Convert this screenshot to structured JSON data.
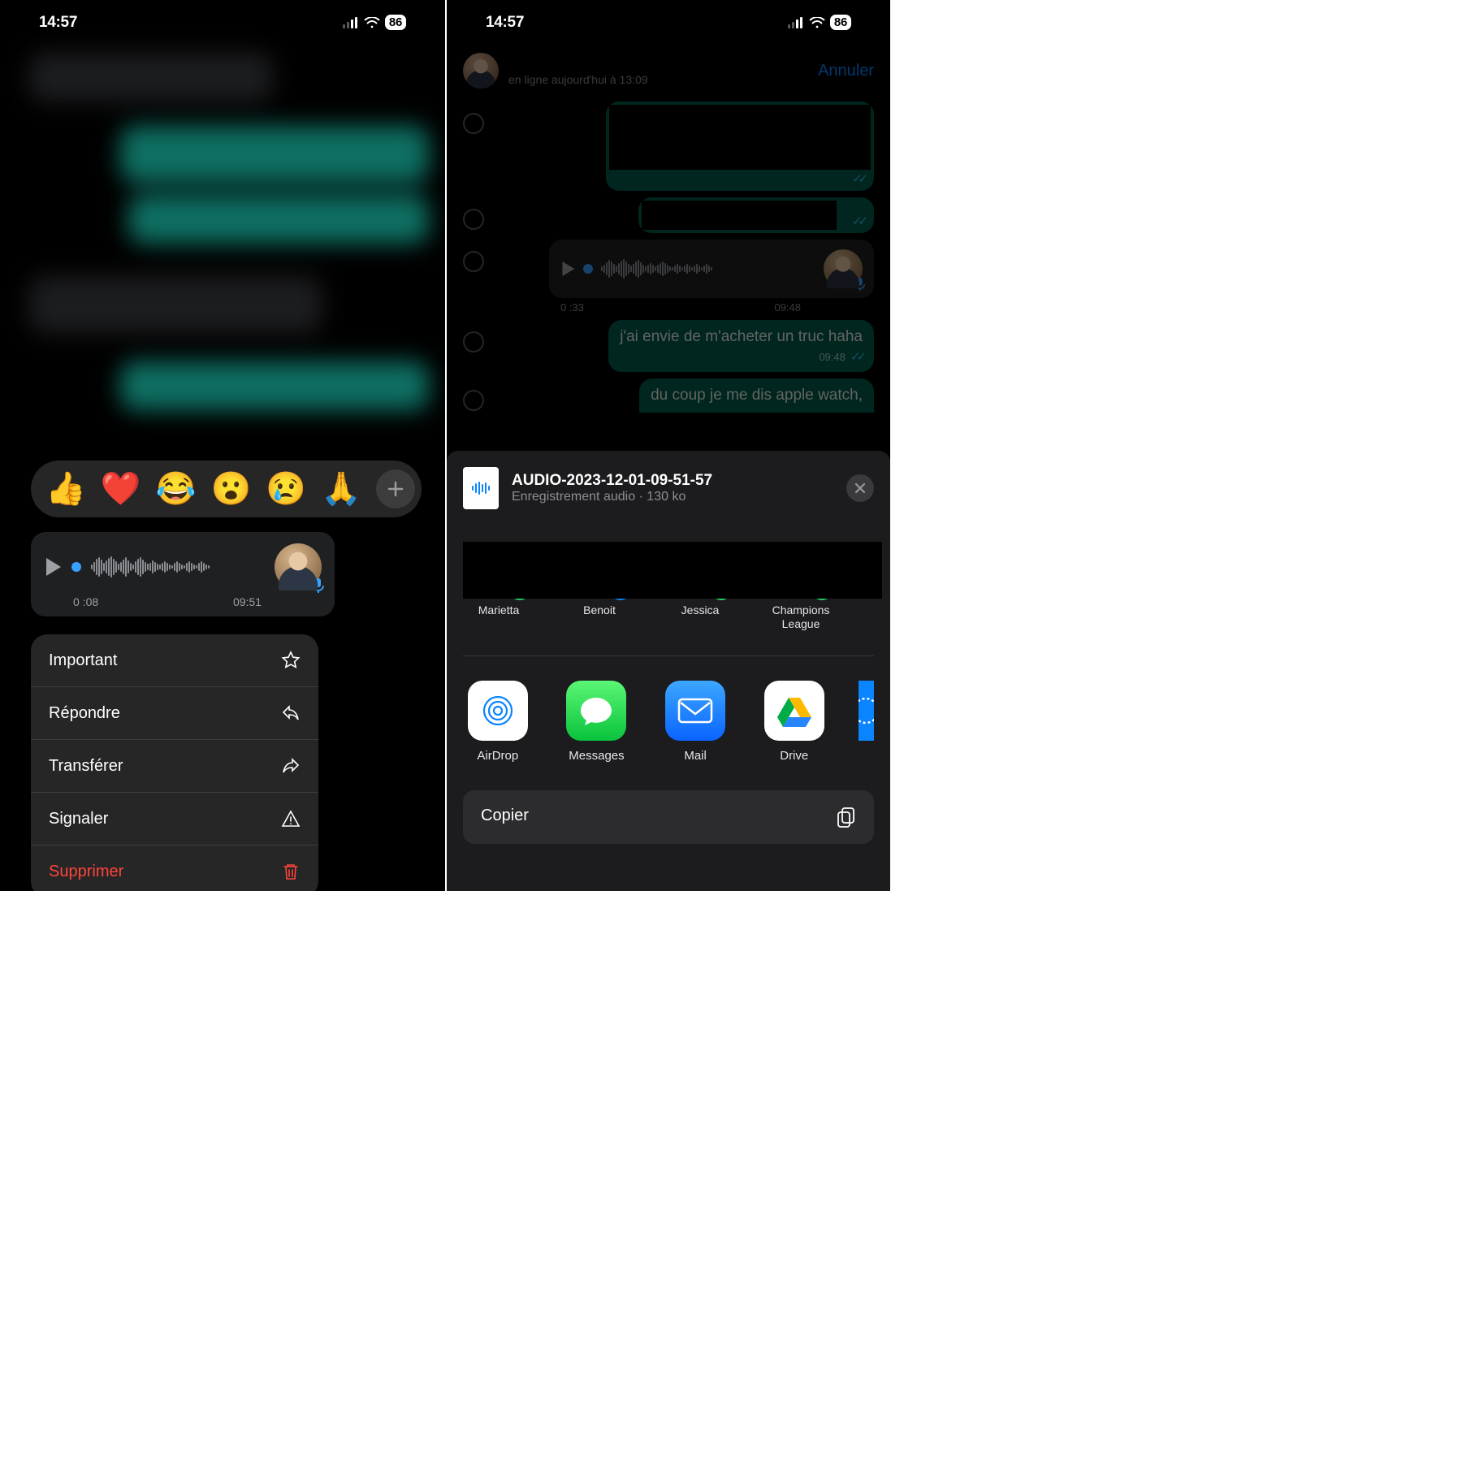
{
  "status": {
    "time": "14:57",
    "battery": "86"
  },
  "left": {
    "reactions": [
      "👍",
      "❤️",
      "😂",
      "😮",
      "😢",
      "🙏"
    ],
    "voice": {
      "position": "0 :08",
      "time": "09:51"
    },
    "menu": {
      "important": "Important",
      "reply": "Répondre",
      "forward": "Transférer",
      "report": "Signaler",
      "delete": "Supprimer"
    }
  },
  "right": {
    "header_status": "en ligne aujourd'hui à 13:09",
    "cancel": "Annuler",
    "voice_in": {
      "position": "0 :33",
      "time": "09:48"
    },
    "msg1": {
      "text": "j'ai envie de m'acheter un truc haha",
      "time": "09:48"
    },
    "msg2": {
      "text": "du coup je me dis apple watch,"
    },
    "share": {
      "file_name": "AUDIO-2023-12-01-09-51-57",
      "file_sub": "Enregistrement audio · 130 ko",
      "contacts": [
        "Marietta",
        "Benoit",
        "Jessica",
        "Champions League"
      ],
      "apps": [
        "AirDrop",
        "Messages",
        "Mail",
        "Drive"
      ],
      "copy": "Copier"
    }
  }
}
